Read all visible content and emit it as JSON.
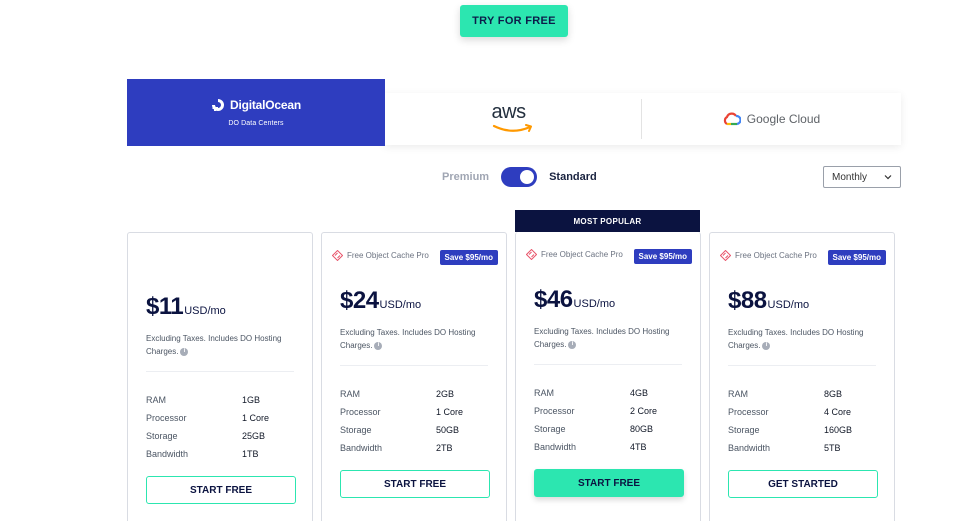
{
  "hero": {
    "cta_label": "TRY FOR FREE"
  },
  "providers": {
    "digitalocean": {
      "name": "DigitalOcean",
      "subtitle": "DO Data Centers"
    },
    "aws": {
      "name": "aws"
    },
    "google": {
      "name": "Google Cloud"
    }
  },
  "toggle": {
    "left_label": "Premium",
    "right_label": "Standard",
    "selected": "Standard"
  },
  "billing_select": {
    "value": "Monthly"
  },
  "popular_label": "MOST POPULAR",
  "colors": {
    "accent": "#2ce6b0",
    "brand": "#2e3dbf",
    "dark": "#0b1340"
  },
  "plans": [
    {
      "promo": "",
      "save": "",
      "price": "$11",
      "unit": "USD/mo",
      "note": "Excluding Taxes. Includes DO Hosting Charges.",
      "specs": [
        {
          "label": "RAM",
          "value": "1GB"
        },
        {
          "label": "Processor",
          "value": "1 Core"
        },
        {
          "label": "Storage",
          "value": "25GB"
        },
        {
          "label": "Bandwidth",
          "value": "1TB"
        }
      ],
      "cta": "START FREE"
    },
    {
      "promo": "Free Object Cache Pro",
      "save": "Save $95/mo",
      "price": "$24",
      "unit": "USD/mo",
      "note": "Excluding Taxes. Includes DO Hosting Charges.",
      "specs": [
        {
          "label": "RAM",
          "value": "2GB"
        },
        {
          "label": "Processor",
          "value": "1 Core"
        },
        {
          "label": "Storage",
          "value": "50GB"
        },
        {
          "label": "Bandwidth",
          "value": "2TB"
        }
      ],
      "cta": "START FREE"
    },
    {
      "promo": "Free Object Cache Pro",
      "save": "Save $95/mo",
      "price": "$46",
      "unit": "USD/mo",
      "note": "Excluding Taxes. Includes DO Hosting Charges.",
      "specs": [
        {
          "label": "RAM",
          "value": "4GB"
        },
        {
          "label": "Processor",
          "value": "2 Core"
        },
        {
          "label": "Storage",
          "value": "80GB"
        },
        {
          "label": "Bandwidth",
          "value": "4TB"
        }
      ],
      "cta": "START FREE"
    },
    {
      "promo": "Free Object Cache Pro",
      "save": "Save $95/mo",
      "price": "$88",
      "unit": "USD/mo",
      "note": "Excluding Taxes. Includes DO Hosting Charges.",
      "specs": [
        {
          "label": "RAM",
          "value": "8GB"
        },
        {
          "label": "Processor",
          "value": "4 Core"
        },
        {
          "label": "Storage",
          "value": "160GB"
        },
        {
          "label": "Bandwidth",
          "value": "5TB"
        }
      ],
      "cta": "GET STARTED"
    }
  ]
}
